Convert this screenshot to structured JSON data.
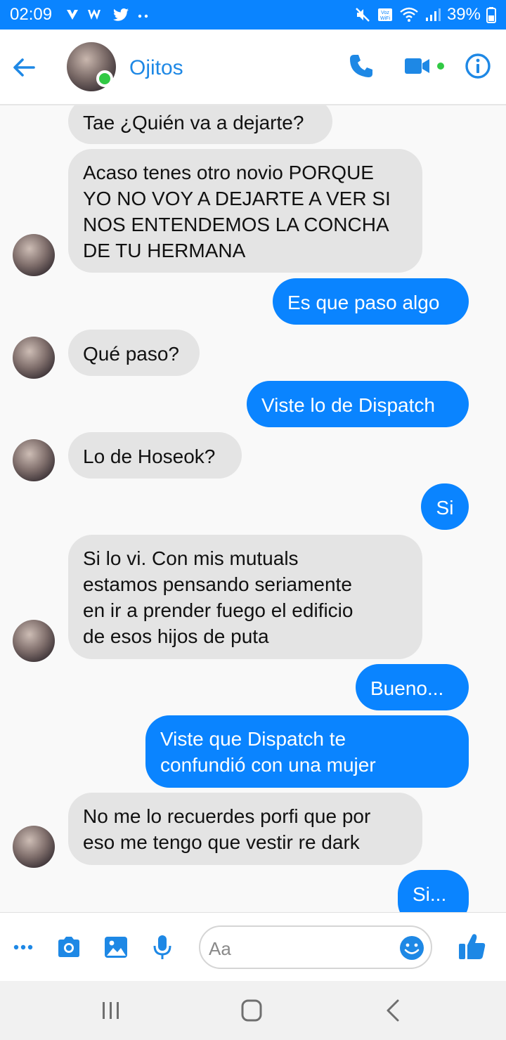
{
  "status_bar": {
    "time": "02:09",
    "battery": "39%",
    "notification_icons": [
      "maps-icon",
      "w-icon",
      "twitter-icon",
      "more-dots-icon"
    ]
  },
  "header": {
    "contact_name": "Ojitos",
    "accent_color": "#0a84ff",
    "online_color": "#31c944"
  },
  "messages": [
    {
      "dir": "in",
      "text": "Tae ¿Quién va a dejarte?"
    },
    {
      "dir": "in",
      "text": "Acaso tenes otro novio PORQUE\nYO NO VOY A DEJARTE A VER SI\nNOS ENTENDEMOS LA CONCHA\nDE TU HERMANA"
    },
    {
      "dir": "out",
      "text": "Es que paso algo"
    },
    {
      "dir": "in",
      "text": "Qué paso?"
    },
    {
      "dir": "out",
      "text": "Viste lo de Dispatch"
    },
    {
      "dir": "in",
      "text": "Lo de Hoseok?"
    },
    {
      "dir": "out",
      "text": "Si"
    },
    {
      "dir": "in",
      "text": "Si lo vi. Con mis mutuals\nestamos pensando seriamente\nen ir a prender fuego el edificio\nde esos hijos de puta"
    },
    {
      "dir": "out",
      "text": "Bueno..."
    },
    {
      "dir": "out",
      "text": "Viste que Dispatch te\nconfundió con una mujer"
    },
    {
      "dir": "in",
      "text": "No me lo recuerdes porfi que por\neso me tengo que vestir re dark"
    },
    {
      "dir": "out",
      "text": "Si..."
    }
  ],
  "composer": {
    "placeholder": "Aa"
  }
}
